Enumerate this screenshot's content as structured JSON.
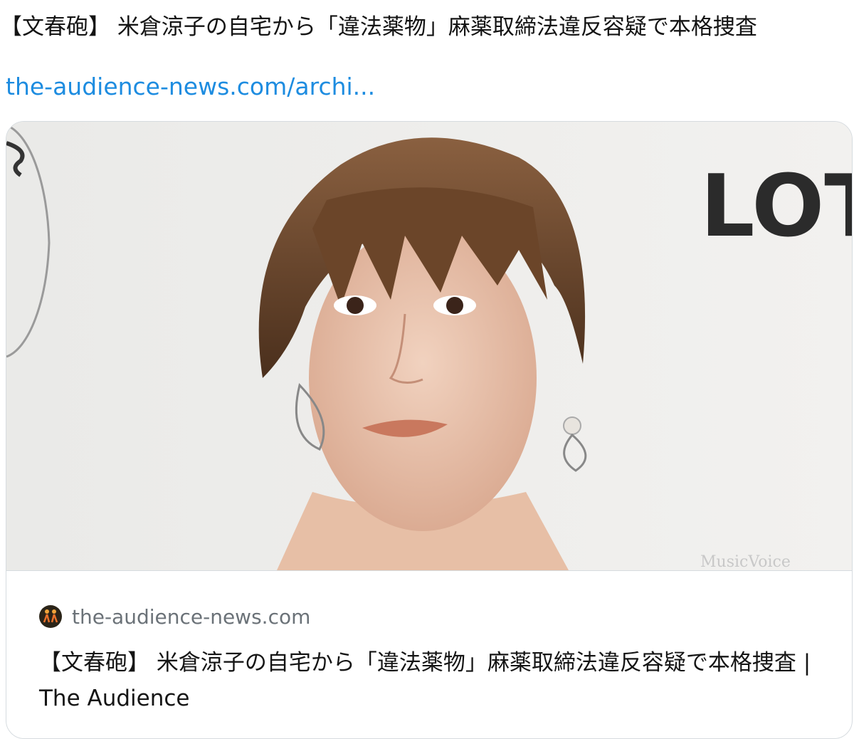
{
  "post": {
    "text": "【文春砲】 米倉涼子の自宅から「違法薬物」麻薬取締法違反容疑で本格捜査",
    "link": "the-audience-news.com/archi..."
  },
  "card": {
    "image_overlay_text": "LOT",
    "watermark_text": "MusicVoice",
    "favicon_icon": "the-audience-logo-icon",
    "domain": "the-audience-news.com",
    "title": "【文春砲】 米倉涼子の自宅から「違法薬物」麻薬取締法違反容疑で本格捜査 | The Audience"
  },
  "colors": {
    "link": "#1d8ce0",
    "domain_text": "#6b7278",
    "border": "#d6dbdf"
  }
}
